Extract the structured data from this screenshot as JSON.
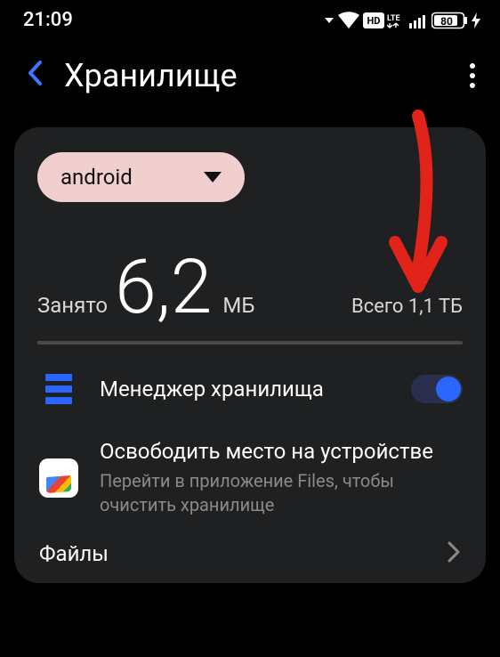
{
  "status": {
    "time": "21:09",
    "battery": "80"
  },
  "header": {
    "title": "Хранилище"
  },
  "account": {
    "label": "android"
  },
  "usage": {
    "used_label": "Занято",
    "used_value": "6,2",
    "used_unit": "МБ",
    "total_text": "Всего 1,1 ТБ"
  },
  "storage_manager": {
    "title": "Менеджер хранилища"
  },
  "free_space": {
    "title": "Освободить место на устройстве",
    "subtitle": "Перейти в приложение Files, чтобы очистить хранилище"
  },
  "files": {
    "label": "Файлы"
  }
}
